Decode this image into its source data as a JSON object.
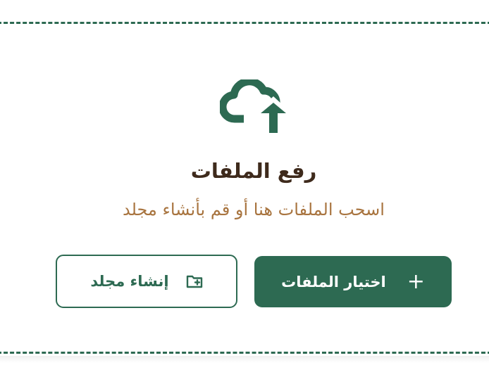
{
  "upload": {
    "icon": "cloud-upload-icon",
    "title": "رفع الملفات",
    "subtitle": "اسحب الملفات هنا أو قم بأنشاء مجلد"
  },
  "actions": {
    "choose_files_label": "اختيار الملفات",
    "choose_files_icon": "+",
    "create_folder_label": "إنشاء مجلد",
    "create_folder_icon": "folder-plus-icon"
  },
  "colors": {
    "primary": "#2d6a52",
    "title": "#3e2a1c",
    "subtitle": "#a8743f"
  }
}
